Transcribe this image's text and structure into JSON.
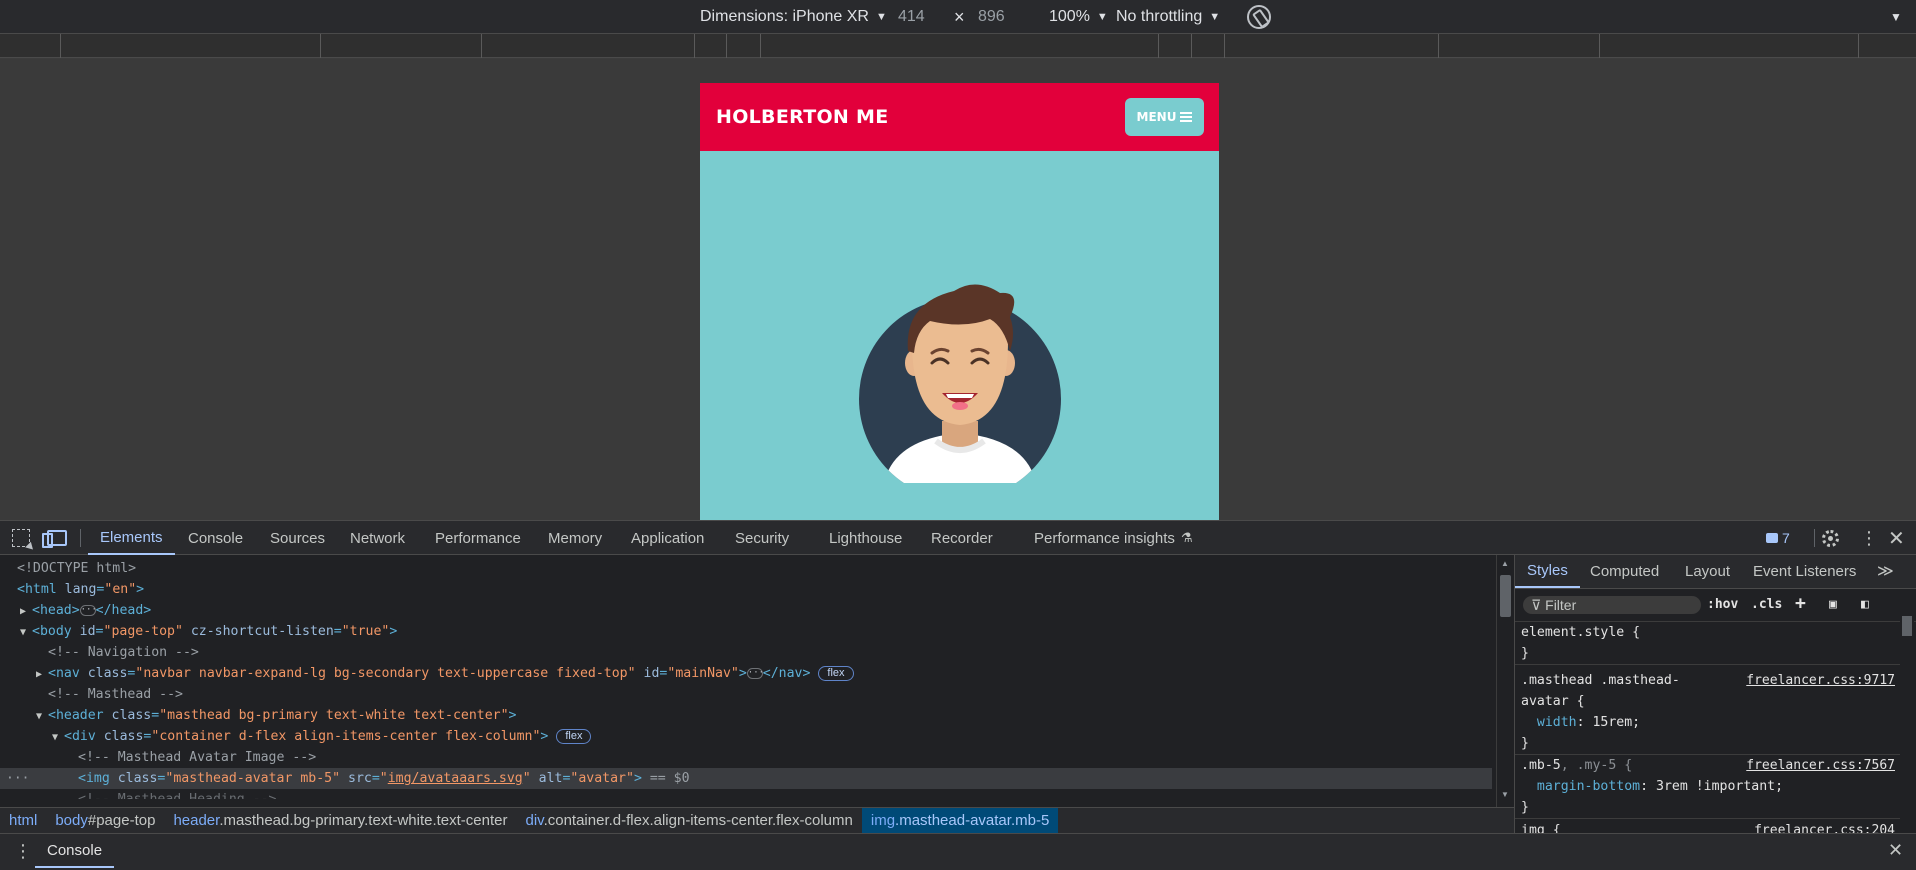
{
  "device_toolbar": {
    "dimensions_label": "Dimensions: iPhone XR",
    "width": "414",
    "times": "×",
    "height": "896",
    "zoom": "100%",
    "throttling": "No throttling"
  },
  "site": {
    "brand": "HOLBERTON ME",
    "menu_label": "MENU",
    "colors": {
      "primary": "#7acccf",
      "secondary": "#e2003b"
    }
  },
  "devtools": {
    "tabs": [
      "Elements",
      "Console",
      "Sources",
      "Network",
      "Performance",
      "Memory",
      "Application",
      "Security",
      "Lighthouse",
      "Recorder",
      "Performance insights"
    ],
    "active_tab": "Elements",
    "issues_count": "7"
  },
  "dom": {
    "doctype": "<!DOCTYPE html>",
    "html_open": {
      "tag": "<html",
      "attr": "lang",
      "val": "\"en\""
    },
    "head_open": "<head>",
    "head_close": "</head>",
    "body": {
      "attr1": "id",
      "val1": "\"page-top\"",
      "attr2": "cz-shortcut-listen",
      "val2": "\"true\""
    },
    "comment_nav": "<!-- Navigation -->",
    "nav": {
      "attr1": "class",
      "val1": "\"navbar navbar-expand-lg bg-secondary text-uppercase fixed-top\"",
      "attr2": "id",
      "val2": "\"mainNav\"",
      "badge": "flex"
    },
    "comment_masthead": "<!-- Masthead -->",
    "header": {
      "attr": "class",
      "val": "\"masthead bg-primary text-white text-center\""
    },
    "div": {
      "attr": "class",
      "val": "\"container d-flex align-items-center flex-column\"",
      "badge": "flex"
    },
    "comment_avatar": "<!-- Masthead Avatar Image -->",
    "img": {
      "attr1": "class",
      "val1": "\"masthead-avatar mb-5\"",
      "attr2": "src",
      "val2": "img/avataaars.svg",
      "attr3": "alt",
      "val3": "\"avatar\"",
      "suffix": "== $0"
    }
  },
  "breadcrumbs": [
    {
      "el": "html",
      "rest": ""
    },
    {
      "el": "body",
      "rest": "#page-top"
    },
    {
      "el": "header",
      "rest": ".masthead.bg-primary.text-white.text-center"
    },
    {
      "el": "div",
      "rest": ".container.d-flex.align-items-center.flex-column"
    },
    {
      "el": "img",
      "rest": ".masthead-avatar.mb-5"
    }
  ],
  "styles_pane": {
    "tabs": [
      "Styles",
      "Computed",
      "Layout",
      "Event Listeners"
    ],
    "filter_placeholder": "Filter",
    "hov": ":hov",
    "cls": ".cls",
    "rules": [
      {
        "selector": "element.style {",
        "close": "}"
      },
      {
        "selector1": ".masthead .masthead-",
        "selector2": "avatar {",
        "source": "freelancer.css:9717",
        "prop": "width",
        "value": "15rem;",
        "close": "}"
      },
      {
        "selector_a": ".mb-5",
        "selector_b": ", .my-5 {",
        "source": "freelancer.css:7567",
        "prop": "margin-bottom",
        "value": "3rem !important;",
        "close": "}"
      },
      {
        "selector": "img {",
        "source": "freelancer.css:204"
      }
    ]
  },
  "drawer": {
    "tab": "Console"
  }
}
